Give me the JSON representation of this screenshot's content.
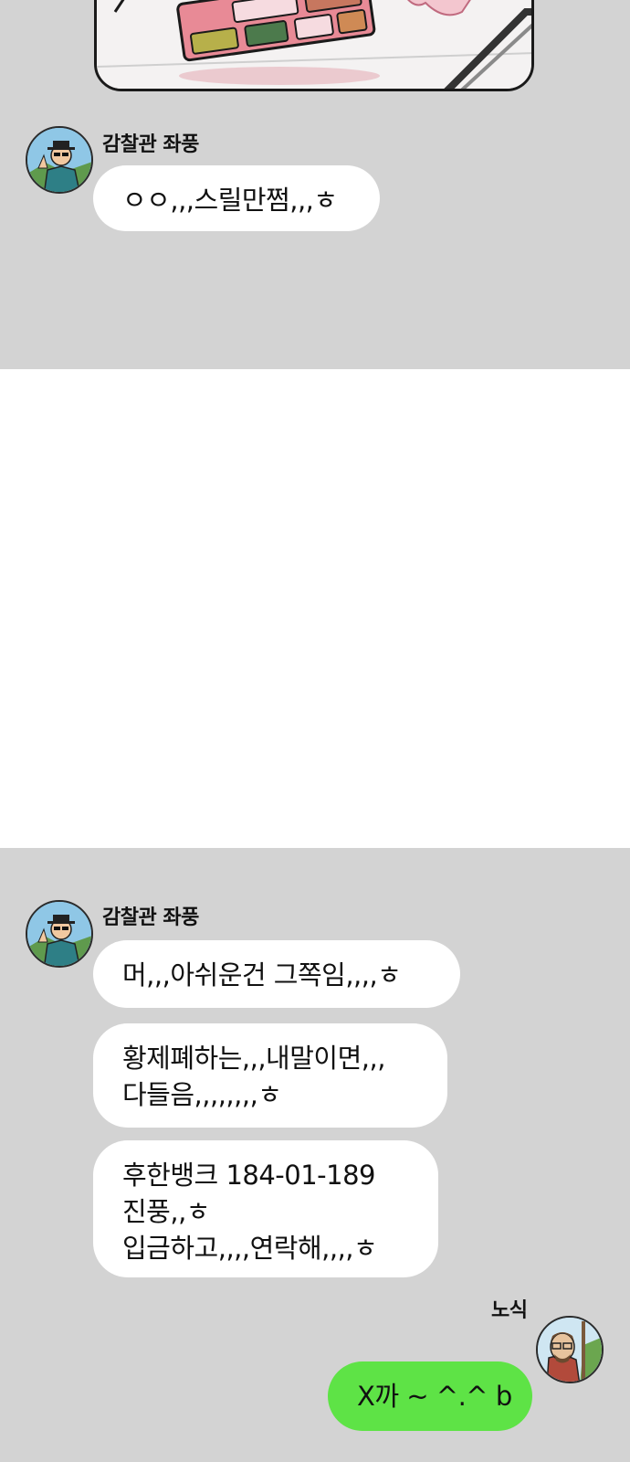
{
  "chat": {
    "top": {
      "sender": "감찰관 좌풍",
      "messages": [
        "ㅇㅇ,,,스릴만쩜,,,ㅎ"
      ]
    },
    "bottom": {
      "sender": "감찰관 좌풍",
      "messages": [
        "머,,,아쉬운건 그쪽임,,,,ㅎ",
        "황제폐하는,,,내말이면,,,\n다들음,,,,,,,,ㅎ",
        "후한뱅크 184-01-189\n진풍,,ㅎ\n입금하고,,,,연락해,,,,ㅎ"
      ]
    },
    "reply": {
      "sender": "노식",
      "message": "X까 ~ ^.^ b"
    }
  },
  "colors": {
    "chat_background": "#d3d3d3",
    "gap_background": "#ffffff",
    "bubble_other": "#ffffff",
    "bubble_mine": "#5ee346"
  },
  "icons": {
    "comic": "comic-panel-lunch-tray",
    "avatar_other": "avatar-jwapung-icon",
    "avatar_mine": "avatar-nosik-icon"
  }
}
